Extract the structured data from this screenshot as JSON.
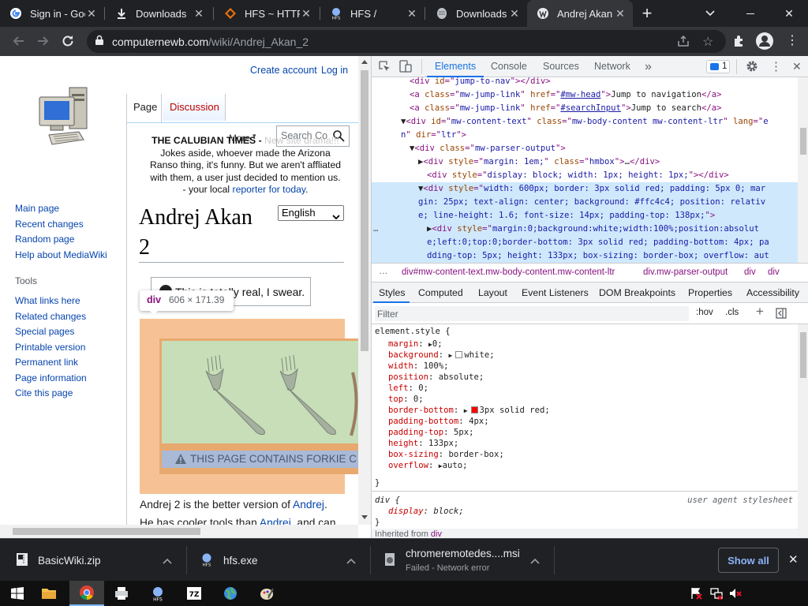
{
  "tabs": [
    {
      "title": "Sign in - Goo",
      "icon": "google-icon"
    },
    {
      "title": "Downloads",
      "icon": "download-icon"
    },
    {
      "title": "HFS ~ HTTP",
      "icon": "hfs-icon"
    },
    {
      "title": "HFS /",
      "icon": "hfs-icon"
    },
    {
      "title": "Downloads",
      "icon": "page-icon"
    },
    {
      "title": "Andrej Akan",
      "icon": "wiki-icon"
    }
  ],
  "url": {
    "domain": "computernewb.com",
    "path": "/wiki/Andrej_Akan_2"
  },
  "wiki": {
    "create_account": "Create account",
    "log_in": "Log in",
    "tab_page": "Page",
    "tab_discussion": "Discussion",
    "more": "More",
    "search_placeholder": "Search Co",
    "nav": [
      "Main page",
      "Recent changes",
      "Random page",
      "Help about MediaWiki"
    ],
    "tools_heading": "Tools",
    "tools": [
      "What links here",
      "Related changes",
      "Special pages",
      "Printable version",
      "Permanent link",
      "Page information",
      "Cite this page"
    ],
    "notice_title": "THE CALUBIAN TIMES - ",
    "notice_overlap": "New site drama!!!",
    "notice_line1": "Jokes aside, whoever made the Arizona",
    "notice_line2": "Ranso thing, it's funny. But we aren't affliated",
    "notice_line3": "with them, a user just decided to mention us.",
    "notice_line4_a": "- your local ",
    "notice_line4_link": "reporter for today",
    "notice_line4_b": ".",
    "title_line1": "Andrej Akan",
    "title_line2": "2",
    "language": "English",
    "tooltip_tag": "div",
    "tooltip_size": "606 × 171.39",
    "callout_text": "This is totally real, I swear.",
    "banner_text": "THIS PAGE CONTAINS FORKIE C",
    "body_line1_a": "Andrej 2 is the better version of ",
    "body_line1_link": "Andrej",
    "body_line1_b": ".",
    "body_line2_a": "He has cooler tools than ",
    "body_line2_link": "Andrei",
    "body_line2_b": ", and can"
  },
  "devtools": {
    "tabs": [
      "Elements",
      "Console",
      "Sources",
      "Network"
    ],
    "issues_count": "1",
    "code_lines": [
      {
        "indent": 4,
        "html": "<span>&lt;div </span><span class='an'>id</span><span>=\"</span><span class='av'>jump-to-nav</span><span>\"&gt;&lt;/div&gt;</span>"
      },
      {
        "indent": 4,
        "html": "<span>&lt;a </span><span class='an'>class</span><span>=\"</span><span class='av'>mw-jump-link</span><span>\" </span><span class='an'>href</span><span>=\"</span><span class='av' style='text-decoration:underline'>#mw-head</span><span>\"&gt;</span><span class='tx'>Jump to navigation</span><span>&lt;/a&gt;</span>"
      },
      {
        "indent": 4,
        "html": "<span>&lt;a </span><span class='an'>class</span><span>=\"</span><span class='av'>mw-jump-link</span><span>\" </span><span class='an'>href</span><span>=\"</span><span class='av' style='text-decoration:underline'>#searchInput</span><span>\"&gt;</span><span class='tx'>Jump to search</span><span>&lt;/a&gt;</span>"
      },
      {
        "indent": 3,
        "html": "<span class='tx'>▼</span><span>&lt;div </span><span class='an'>id</span><span>=\"</span><span class='av'>mw-content-text</span><span>\" </span><span class='an'>class</span><span>=\"</span><span class='av'>mw-body-content mw-content-ltr</span><span>\" </span><span class='an'>lang</span><span>=\"</span><span class='av'>e</span>"
      },
      {
        "indent": 3,
        "html": "<span class='av'>n</span><span>\" </span><span class='an'>dir</span><span>=\"</span><span class='av'>ltr</span><span>\"&gt;</span>"
      },
      {
        "indent": 4,
        "html": "<span class='tx'>▼</span><span>&lt;div </span><span class='an'>class</span><span>=\"</span><span class='av'>mw-parser-output</span><span>\"&gt;</span>"
      },
      {
        "indent": 5,
        "html": "<span class='tx'>▶</span><span>&lt;div </span><span class='an'>style</span><span>=\"</span><span class='av'>margin: 1em;</span><span>\" </span><span class='an'>class</span><span>=\"</span><span class='av'>hmbox</span><span>\"&gt;</span><span class='tx'>…</span><span>&lt;/div&gt;</span>"
      },
      {
        "indent": 6,
        "html": "<span>&lt;div </span><span class='an'>style</span><span>=\"</span><span class='av'>display: block; width: 1px; height: 1px;</span><span>\"&gt;&lt;/div&gt;</span>"
      },
      {
        "indent": 5,
        "sel": true,
        "html": "<span class='tx'>▼</span><span>&lt;div </span><span class='an'>style</span><span>=\"</span><span class='av'>width: 600px; border: 3px solid red; padding: 5px 0; mar</span>"
      },
      {
        "indent": 5,
        "sel": true,
        "html": "<span class='av'>gin: 25px; text-align: center; background: #ffc4c4; position: relativ</span>"
      },
      {
        "indent": 5,
        "sel": true,
        "html": "<span class='av'>e; line-height: 1.6; font-size: 14px; padding-top: 138px;</span><span>\"&gt;</span>"
      },
      {
        "indent": 6,
        "sel": true,
        "html": "<span class='tx'>▶</span><span>&lt;div </span><span class='an'>style</span><span>=\"</span><span class='av'>margin:0;background:white;width:100%;position:absolut</span>"
      },
      {
        "indent": 6,
        "sel": true,
        "html": "<span class='av'>e;left:0;top:0;border-bottom: 3px solid red; padding-bottom: 4px; pa</span>"
      },
      {
        "indent": 6,
        "sel": true,
        "html": "<span class='av'>dding-top: 5px; height: 133px; box-sizing: border-box; overflow: aut</span>"
      }
    ],
    "breadcrumb": [
      "div#mw-content-text.mw-body-content.mw-content-ltr",
      "div.mw-parser-output",
      "div",
      "div"
    ],
    "panel_tabs": [
      "Styles",
      "Computed",
      "Layout",
      "Event Listeners",
      "DOM Breakpoints",
      "Properties",
      "Accessibility"
    ],
    "filter_placeholder": "Filter",
    "hov": ":hov",
    "cls": ".cls",
    "element_style_selector": "element.style {",
    "props": [
      {
        "name": "margin",
        "value": "0",
        "arrow": true
      },
      {
        "name": "background",
        "value": "white",
        "arrow": true,
        "swatch": "#ffffff"
      },
      {
        "name": "width",
        "value": "100%"
      },
      {
        "name": "position",
        "value": "absolute"
      },
      {
        "name": "left",
        "value": "0"
      },
      {
        "name": "top",
        "value": "0"
      },
      {
        "name": "border-bottom",
        "value": "3px solid red",
        "arrow": true,
        "swatch": "#ff0000"
      },
      {
        "name": "padding-bottom",
        "value": "4px"
      },
      {
        "name": "padding-top",
        "value": "5px"
      },
      {
        "name": "height",
        "value": "133px"
      },
      {
        "name": "box-sizing",
        "value": "border-box"
      },
      {
        "name": "overflow",
        "value": "auto",
        "arrow": true
      }
    ],
    "ua_selector": "div {",
    "ua_label": "user agent stylesheet",
    "ua_prop": "display",
    "ua_value": "block",
    "inherited": "Inherited from ",
    "inherited_tag": "div"
  },
  "downloads": [
    {
      "name": "BasicWiki.zip",
      "status": ""
    },
    {
      "name": "hfs.exe",
      "status": ""
    },
    {
      "name": "chromeremotedes....msi",
      "status": "Failed - Network error"
    }
  ],
  "show_all": "Show all"
}
